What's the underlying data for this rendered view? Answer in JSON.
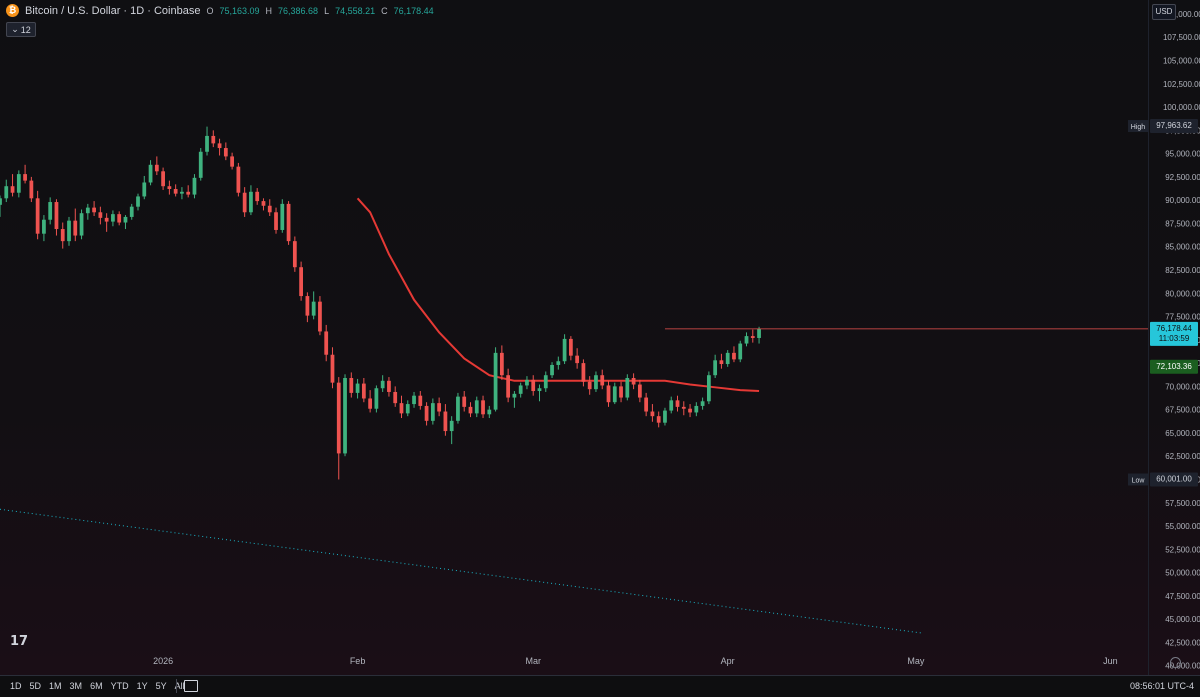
{
  "legend": {
    "coin_icon": "bitcoin-icon",
    "symbol": "Bitcoin / U.S. Dollar · 1D · Coinbase",
    "ohlc": [
      {
        "k": "O",
        "v": "75,163.09"
      },
      {
        "k": "H",
        "v": "76,386.68"
      },
      {
        "k": "L",
        "v": "74,558.21"
      },
      {
        "k": "C",
        "v": "76,178.44"
      }
    ]
  },
  "indicator_toggle": "12",
  "currency": "USD",
  "timeframes": [
    "1D",
    "5D",
    "1M",
    "3M",
    "6M",
    "YTD",
    "1Y",
    "5Y",
    "All"
  ],
  "clock": "08:56:01 UTC-4",
  "logo": "17",
  "colors": {
    "bg": "#0e0e10",
    "up": "#3fb27f",
    "down": "#ef5350",
    "orange": "#f5a623",
    "teal_dotted": "#1ab5c8",
    "ma_red": "#e53935",
    "ma_green": "#2e7d32"
  },
  "chart_data": {
    "type": "candlestick",
    "symbol": "BTCUSD",
    "interval": "1D",
    "ylim": [
      39000,
      111500
    ],
    "y_ticks": [
      110000,
      107500,
      105000,
      102500,
      100000,
      97500,
      95000,
      92500,
      90000,
      87500,
      85000,
      82500,
      80000,
      77500,
      75000,
      72500,
      70000,
      67500,
      65000,
      62500,
      60000,
      57500,
      55000,
      52500,
      50000,
      47500,
      45000,
      42500,
      40000
    ],
    "y_tick_labels": [
      "110,000.00",
      "107,500.00",
      "105,000.00",
      "102,500.00",
      "100,000.00",
      "97,500.00",
      "95,000.00",
      "92,500.00",
      "90,000.00",
      "87,500.00",
      "85,000.00",
      "82,500.00",
      "80,000.00",
      "77,500.00",
      "75,000.00",
      "72,500.00",
      "70,000.00",
      "67,500.00",
      "65,000.00",
      "62,500.00",
      "60,000.00",
      "57,500.00",
      "55,000.00",
      "52,500.00",
      "50,000.00",
      "47,500.00",
      "45,000.00",
      "42,500.00",
      "40,000.00"
    ],
    "x_labels": [
      {
        "label": "2026",
        "day": 26
      },
      {
        "label": "Feb",
        "day": 57
      },
      {
        "label": "Mar",
        "day": 85
      },
      {
        "label": "Apr",
        "day": 116
      },
      {
        "label": "May",
        "day": 146
      },
      {
        "label": "Jun",
        "day": 177
      }
    ],
    "day_range": [
      0,
      183
    ],
    "badges": [
      {
        "label": "High",
        "value": "97,963.62",
        "price": 97963.62
      },
      {
        "label": "Low",
        "value": "60,001.00",
        "price": 60001
      }
    ],
    "last_price": {
      "value": "76,178.44",
      "countdown": "11:03:59",
      "price": 76178.44
    },
    "green_level": {
      "value": "72,103.36",
      "price": 72103.36
    },
    "candles": [
      [
        89500,
        90500,
        88200,
        90200
      ],
      [
        90200,
        92200,
        89800,
        91500
      ],
      [
        91500,
        92800,
        90400,
        90800
      ],
      [
        90800,
        93200,
        90300,
        92800
      ],
      [
        92800,
        93800,
        91800,
        92100
      ],
      [
        92100,
        92500,
        89800,
        90200
      ],
      [
        90200,
        91000,
        85800,
        86400
      ],
      [
        86400,
        88400,
        85600,
        87900
      ],
      [
        87900,
        90300,
        87400,
        89800
      ],
      [
        89800,
        90100,
        86200,
        86900
      ],
      [
        86900,
        87600,
        84800,
        85600
      ],
      [
        85600,
        88200,
        85100,
        87800
      ],
      [
        87800,
        89100,
        85600,
        86200
      ],
      [
        86200,
        89000,
        85800,
        88600
      ],
      [
        88600,
        89600,
        87900,
        89200
      ],
      [
        89200,
        89900,
        88300,
        88700
      ],
      [
        88700,
        89300,
        87400,
        88100
      ],
      [
        88100,
        88600,
        86600,
        87700
      ],
      [
        87700,
        88900,
        87200,
        88500
      ],
      [
        88500,
        88800,
        87300,
        87600
      ],
      [
        87600,
        88400,
        86900,
        88200
      ],
      [
        88200,
        89600,
        87900,
        89300
      ],
      [
        89300,
        90700,
        88900,
        90400
      ],
      [
        90400,
        92600,
        90100,
        91900
      ],
      [
        91900,
        94300,
        91600,
        93800
      ],
      [
        93800,
        94700,
        92700,
        93100
      ],
      [
        93100,
        93500,
        91100,
        91500
      ],
      [
        91500,
        92100,
        90600,
        91200
      ],
      [
        91200,
        91700,
        90400,
        90700
      ],
      [
        90700,
        91400,
        90100,
        90900
      ],
      [
        90900,
        91600,
        90300,
        90600
      ],
      [
        90600,
        92800,
        90200,
        92400
      ],
      [
        92400,
        95600,
        92100,
        95200
      ],
      [
        95200,
        97900,
        94800,
        96900
      ],
      [
        96900,
        97500,
        95700,
        96100
      ],
      [
        96100,
        96600,
        94800,
        95600
      ],
      [
        95600,
        96200,
        94300,
        94700
      ],
      [
        94700,
        95100,
        93300,
        93600
      ],
      [
        93600,
        94000,
        90400,
        90800
      ],
      [
        90800,
        91400,
        88200,
        88700
      ],
      [
        88700,
        91600,
        88400,
        90900
      ],
      [
        90900,
        91300,
        89500,
        89900
      ],
      [
        89900,
        90200,
        88900,
        89400
      ],
      [
        89400,
        90100,
        88300,
        88700
      ],
      [
        88700,
        89200,
        86400,
        86800
      ],
      [
        86800,
        90100,
        86500,
        89600
      ],
      [
        89600,
        89900,
        85200,
        85600
      ],
      [
        85600,
        86100,
        82300,
        82800
      ],
      [
        82800,
        83400,
        79200,
        79700
      ],
      [
        79700,
        80100,
        76900,
        77600
      ],
      [
        77600,
        80200,
        77200,
        79100
      ],
      [
        79100,
        79700,
        75500,
        75900
      ],
      [
        75900,
        76600,
        72700,
        73400
      ],
      [
        73400,
        74200,
        69800,
        70400
      ],
      [
        70400,
        71000,
        60001,
        62800
      ],
      [
        62800,
        71300,
        62500,
        70900
      ],
      [
        70900,
        71500,
        68800,
        69300
      ],
      [
        69300,
        70800,
        68700,
        70300
      ],
      [
        70300,
        70900,
        68300,
        68700
      ],
      [
        68700,
        69600,
        67200,
        67600
      ],
      [
        67600,
        70100,
        67200,
        69800
      ],
      [
        69800,
        71200,
        69400,
        70600
      ],
      [
        70600,
        71000,
        68900,
        69400
      ],
      [
        69400,
        70000,
        67800,
        68200
      ],
      [
        68200,
        69000,
        66600,
        67100
      ],
      [
        67100,
        68500,
        66800,
        68100
      ],
      [
        68100,
        69400,
        67700,
        69000
      ],
      [
        69000,
        69500,
        67500,
        67900
      ],
      [
        67900,
        68300,
        65800,
        66300
      ],
      [
        66300,
        68700,
        65900,
        68200
      ],
      [
        68200,
        68800,
        66800,
        67300
      ],
      [
        67300,
        68100,
        64700,
        65200
      ],
      [
        65200,
        66800,
        63800,
        66300
      ],
      [
        66300,
        69300,
        66000,
        68900
      ],
      [
        68900,
        69500,
        67300,
        67800
      ],
      [
        67800,
        68300,
        66700,
        67100
      ],
      [
        67100,
        68900,
        66700,
        68500
      ],
      [
        68500,
        69000,
        66600,
        67000
      ],
      [
        67000,
        67900,
        66600,
        67500
      ],
      [
        67500,
        74200,
        67300,
        73600
      ],
      [
        73600,
        74400,
        70700,
        71200
      ],
      [
        71200,
        71900,
        68300,
        68800
      ],
      [
        68800,
        69500,
        67700,
        69200
      ],
      [
        69200,
        70400,
        68800,
        70100
      ],
      [
        70100,
        71100,
        69700,
        70700
      ],
      [
        70700,
        71200,
        69000,
        69500
      ],
      [
        69500,
        70200,
        68400,
        69800
      ],
      [
        69800,
        71600,
        69400,
        71200
      ],
      [
        71200,
        72600,
        70900,
        72300
      ],
      [
        72300,
        73200,
        71800,
        72700
      ],
      [
        72700,
        75600,
        72400,
        75100
      ],
      [
        75100,
        75400,
        72800,
        73300
      ],
      [
        73300,
        74100,
        71900,
        72500
      ],
      [
        72500,
        72900,
        70000,
        70500
      ],
      [
        70500,
        71100,
        69100,
        69700
      ],
      [
        69700,
        71600,
        69400,
        71200
      ],
      [
        71200,
        71800,
        69700,
        70100
      ],
      [
        70100,
        70600,
        67800,
        68300
      ],
      [
        68300,
        70400,
        68100,
        70000
      ],
      [
        70000,
        70500,
        68300,
        68800
      ],
      [
        68800,
        71300,
        68500,
        70900
      ],
      [
        70900,
        71400,
        69700,
        70200
      ],
      [
        70200,
        70700,
        68300,
        68800
      ],
      [
        68800,
        69300,
        66800,
        67300
      ],
      [
        67300,
        68100,
        66200,
        66800
      ],
      [
        66800,
        67300,
        65600,
        66100
      ],
      [
        66100,
        67700,
        65800,
        67400
      ],
      [
        67400,
        68900,
        67100,
        68500
      ],
      [
        68500,
        69000,
        67300,
        67800
      ],
      [
        67800,
        68400,
        66900,
        67600
      ],
      [
        67600,
        68100,
        66700,
        67200
      ],
      [
        67200,
        68300,
        66800,
        67900
      ],
      [
        67900,
        68800,
        67500,
        68400
      ],
      [
        68400,
        71600,
        68100,
        71200
      ],
      [
        71200,
        73400,
        70900,
        72800
      ],
      [
        72800,
        73500,
        71900,
        72400
      ],
      [
        72400,
        73900,
        72100,
        73600
      ],
      [
        73600,
        74300,
        72600,
        72900
      ],
      [
        72900,
        74900,
        72600,
        74600
      ],
      [
        74600,
        75800,
        74300,
        75400
      ],
      [
        75400,
        76100,
        74700,
        75200
      ],
      [
        75200,
        76400,
        74600,
        76178
      ]
    ],
    "series": [
      {
        "name": "",
        "kind": "moving-average",
        "color": "#e53935",
        "points": [
          [
            57,
            90200
          ],
          [
            59,
            88700
          ],
          [
            62,
            84200
          ],
          [
            66,
            79300
          ],
          [
            70,
            75800
          ],
          [
            74,
            73000
          ],
          [
            78,
            71200
          ],
          [
            82,
            70600
          ],
          [
            90,
            70600
          ],
          [
            98,
            70600
          ],
          [
            106,
            70600
          ],
          [
            110,
            70200
          ],
          [
            114,
            69900
          ],
          [
            118,
            69600
          ],
          [
            121,
            69500
          ]
        ]
      },
      {
        "name": "",
        "kind": "trend-line",
        "color": "#1ab5c8",
        "style": "dotted",
        "points": [
          [
            0,
            56800
          ],
          [
            147,
            43500
          ]
        ]
      }
    ],
    "grid": false,
    "legend_placement": "top-left"
  }
}
